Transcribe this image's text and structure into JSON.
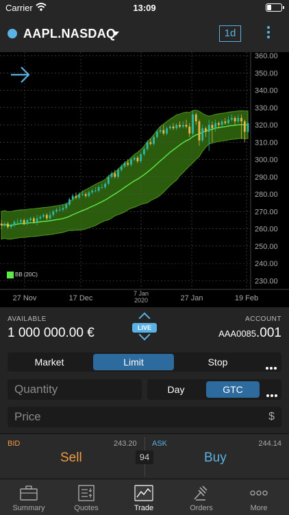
{
  "status_bar": {
    "carrier": "Carrier",
    "time": "13:09"
  },
  "header": {
    "symbol": "AAPL.NASDAQ",
    "timeframe": "1d"
  },
  "chart_data": {
    "type": "candlestick",
    "indicator_label": "BB (20C)",
    "y_ticks": [
      "360.00",
      "350.00",
      "340.00",
      "330.00",
      "320.00",
      "310.00",
      "300.00",
      "290.00",
      "280.00",
      "270.00",
      "260.00",
      "250.00",
      "240.00",
      "230.00"
    ],
    "ylim": [
      225,
      362
    ],
    "x_ticks": [
      {
        "label": "27 Nov",
        "line2": ""
      },
      {
        "label": "17 Dec",
        "line2": ""
      },
      {
        "label": "7 Jan",
        "line2": "2020"
      },
      {
        "label": "27 Jan",
        "line2": ""
      },
      {
        "label": "19 Feb",
        "line2": ""
      }
    ],
    "grid": true,
    "colors": {
      "up": "#2fb7a8",
      "down": "#e6b84a",
      "band": "#3a7a10",
      "middle": "#5eea48"
    },
    "candles": [
      [
        263,
        262,
        265,
        260
      ],
      [
        262,
        263,
        264,
        261
      ],
      [
        263,
        261,
        264,
        260
      ],
      [
        261,
        262,
        263,
        260
      ],
      [
        262,
        264,
        265,
        261
      ],
      [
        264,
        264,
        266,
        263
      ],
      [
        264,
        265,
        266,
        263
      ],
      [
        265,
        263,
        266,
        262
      ],
      [
        263,
        265,
        266,
        262
      ],
      [
        265,
        266,
        267,
        264
      ],
      [
        266,
        264,
        267,
        263
      ],
      [
        264,
        266,
        268,
        262
      ],
      [
        266,
        267,
        268,
        265
      ],
      [
        267,
        268,
        269,
        266
      ],
      [
        268,
        266,
        269,
        265
      ],
      [
        266,
        268,
        270,
        265
      ],
      [
        268,
        270,
        271,
        267
      ],
      [
        270,
        271,
        272,
        269
      ],
      [
        271,
        271,
        273,
        270
      ],
      [
        271,
        272,
        274,
        270
      ],
      [
        272,
        274,
        275,
        271
      ],
      [
        274,
        277,
        278,
        273
      ],
      [
        277,
        279,
        280,
        276
      ],
      [
        279,
        278,
        281,
        277
      ],
      [
        278,
        280,
        281,
        277
      ],
      [
        280,
        280,
        282,
        279
      ],
      [
        280,
        279,
        281,
        278
      ],
      [
        279,
        281,
        282,
        278
      ],
      [
        281,
        282,
        283,
        280
      ],
      [
        282,
        282,
        284,
        281
      ],
      [
        282,
        284,
        285,
        281
      ],
      [
        284,
        284,
        286,
        283
      ],
      [
        284,
        286,
        287,
        283
      ],
      [
        286,
        290,
        291,
        285
      ],
      [
        290,
        292,
        293,
        289
      ],
      [
        292,
        290,
        294,
        289
      ],
      [
        290,
        294,
        295,
        289
      ],
      [
        294,
        296,
        297,
        293
      ],
      [
        296,
        298,
        299,
        295
      ],
      [
        298,
        297,
        300,
        296
      ],
      [
        297,
        300,
        301,
        296
      ],
      [
        300,
        301,
        302,
        299
      ],
      [
        301,
        299,
        302,
        298
      ],
      [
        299,
        303,
        304,
        298
      ],
      [
        303,
        306,
        307,
        302
      ],
      [
        306,
        310,
        311,
        305
      ],
      [
        310,
        309,
        312,
        308
      ],
      [
        309,
        313,
        314,
        308
      ],
      [
        313,
        316,
        317,
        312
      ],
      [
        316,
        317,
        319,
        315
      ],
      [
        317,
        315,
        320,
        314
      ],
      [
        315,
        318,
        319,
        314
      ],
      [
        318,
        319,
        320,
        317
      ],
      [
        319,
        318,
        321,
        317
      ],
      [
        318,
        320,
        321,
        317
      ],
      [
        320,
        319,
        322,
        318
      ],
      [
        319,
        320,
        322,
        318
      ],
      [
        320,
        319,
        323,
        318
      ],
      [
        319,
        315,
        321,
        313
      ],
      [
        315,
        326,
        328,
        314
      ],
      [
        326,
        322,
        327,
        320
      ],
      [
        322,
        311,
        323,
        308
      ],
      [
        311,
        318,
        320,
        310
      ],
      [
        318,
        316,
        319,
        313
      ],
      [
        316,
        320,
        323,
        305
      ],
      [
        320,
        318,
        322,
        310
      ],
      [
        318,
        321,
        323,
        316
      ],
      [
        321,
        320,
        322,
        318
      ],
      [
        320,
        322,
        323,
        319
      ],
      [
        322,
        321,
        324,
        320
      ],
      [
        321,
        323,
        325,
        320
      ],
      [
        323,
        324,
        326,
        322
      ],
      [
        324,
        322,
        325,
        320
      ],
      [
        322,
        324,
        326,
        321
      ],
      [
        324,
        322,
        326,
        312
      ],
      [
        322,
        316,
        323,
        310
      ],
      [
        316,
        321,
        322,
        315
      ]
    ]
  },
  "account": {
    "available_label": "AVAILABLE",
    "available_value": "1 000 000.00 €",
    "account_label": "ACCOUNT",
    "account_value": "AAA0085",
    "account_suffix": ".001",
    "live_label": "LIVE"
  },
  "order_types": {
    "items": [
      "Market",
      "Limit",
      "Stop"
    ],
    "selected": "Limit"
  },
  "quantity": {
    "placeholder": "Quantity"
  },
  "time_in_force": {
    "items": [
      "Day",
      "GTC"
    ],
    "selected": "GTC"
  },
  "price": {
    "placeholder": "Price",
    "currency": "$"
  },
  "trade": {
    "bid_label": "BID",
    "bid_value": "243.20",
    "sell_label": "Sell",
    "ask_label": "ASK",
    "ask_value": "244.14",
    "buy_label": "Buy",
    "spread": "94"
  },
  "tabs": [
    {
      "label": "Summary",
      "icon": "briefcase-icon"
    },
    {
      "label": "Quotes",
      "icon": "quotes-list-icon"
    },
    {
      "label": "Trade",
      "icon": "trade-chart-icon",
      "active": true
    },
    {
      "label": "Orders",
      "icon": "gavel-icon"
    },
    {
      "label": "More",
      "icon": "more-dots-icon"
    }
  ]
}
